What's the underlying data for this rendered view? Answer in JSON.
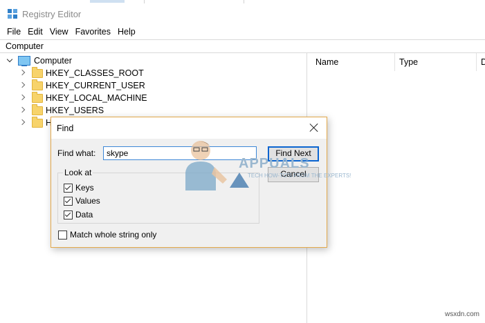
{
  "window": {
    "title": "Registry Editor"
  },
  "menu": [
    "File",
    "Edit",
    "View",
    "Favorites",
    "Help"
  ],
  "address": "Computer",
  "tree": {
    "root": "Computer",
    "items": [
      "HKEY_CLASSES_ROOT",
      "HKEY_CURRENT_USER",
      "HKEY_LOCAL_MACHINE",
      "HKEY_USERS",
      "HK"
    ]
  },
  "list": {
    "columns": [
      "Name",
      "Type",
      "D"
    ]
  },
  "dialog": {
    "title": "Find",
    "find_what_label": "Find what:",
    "find_what_value": "skype",
    "find_next": "Find Next",
    "cancel": "Cancel",
    "look_at": "Look at",
    "checks": [
      {
        "label": "Keys",
        "checked": true
      },
      {
        "label": "Values",
        "checked": true
      },
      {
        "label": "Data",
        "checked": true
      }
    ],
    "match_whole": {
      "label": "Match whole string only",
      "checked": false
    }
  },
  "watermark": {
    "brand": "APPUALS",
    "tagline": "TECH HOW-TO'S FROM THE EXPERTS!"
  },
  "site": "wsxdn.com",
  "colors": {
    "accent": "#0a64d0",
    "dialog_border": "#e3a84a",
    "folder": "#f7d36b"
  }
}
